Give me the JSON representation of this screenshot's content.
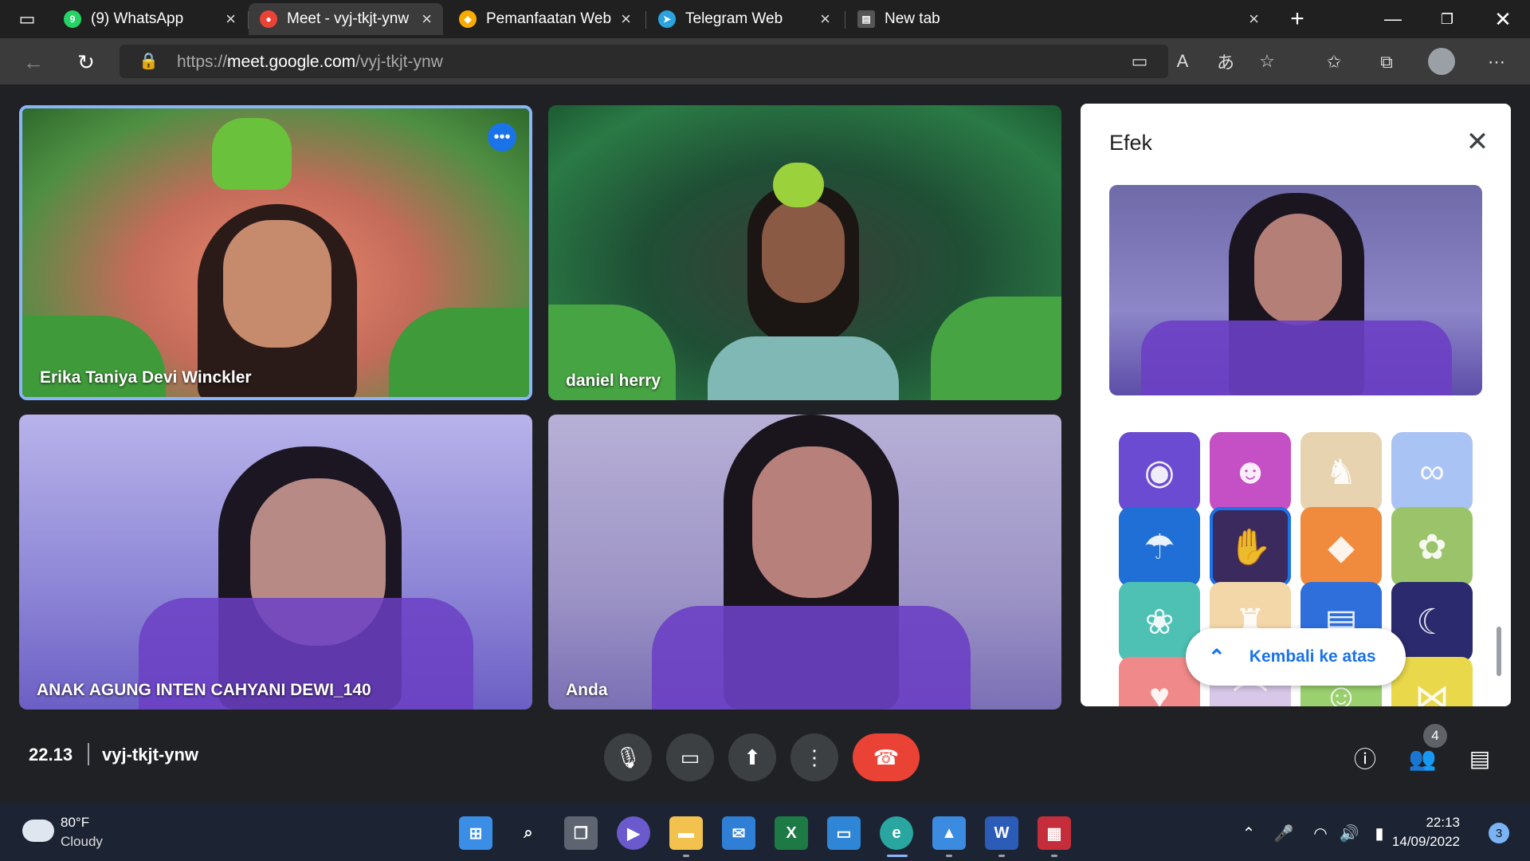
{
  "browser": {
    "tabs": [
      {
        "label": "(9) WhatsApp",
        "favicon": "whatsapp-icon",
        "color": "#25d366",
        "badge": "9"
      },
      {
        "label": "Meet - vyj-tkjt-ynw",
        "favicon": "meet-icon",
        "color": "#ea4335",
        "active": true
      },
      {
        "label": "Pemanfaatan Web Sebaga",
        "favicon": "site-icon",
        "color": "#f9ab00"
      },
      {
        "label": "Telegram Web",
        "favicon": "telegram-icon",
        "color": "#2aa3de"
      },
      {
        "label": "New tab",
        "favicon": "newtab-icon",
        "color": "#555555"
      }
    ],
    "url_scheme": "https://",
    "url_host": "meet.google.com",
    "url_path": "/vyj-tkjt-ynw"
  },
  "meet": {
    "participants": [
      {
        "name": "Erika Taniya Devi Winckler",
        "background": "jungle",
        "speaking": true
      },
      {
        "name": "daniel herry",
        "background": "jungle"
      },
      {
        "name": "ANAK AGUNG INTEN CAHYANI DEWI_140",
        "background": "purple-hands"
      },
      {
        "name": "Anda",
        "background": "purple-hands"
      }
    ],
    "effects_panel": {
      "title": "Efek",
      "back_to_top_label": "Kembali ke atas",
      "effects": [
        {
          "icon": "monster-effect-icon",
          "color": "#6b4bd1"
        },
        {
          "icon": "dinosaur-effect-icon",
          "color": "#c54fc5"
        },
        {
          "icon": "dog-effect-icon",
          "color": "#e7d3b0"
        },
        {
          "icon": "cat-glasses-effect-icon",
          "color": "#a9c3f5"
        },
        {
          "icon": "jellyfish-effect-icon",
          "color": "#1f6fd6"
        },
        {
          "icon": "purple-hands-effect-icon",
          "color": "#3b2a5e",
          "selected": true
        },
        {
          "icon": "fish-effect-icon",
          "color": "#f08a3c"
        },
        {
          "icon": "flower-effect-icon",
          "color": "#9bc46a"
        },
        {
          "icon": "daisy-effect-icon",
          "color": "#4fc1b4"
        },
        {
          "icon": "castle-effect-icon",
          "color": "#f3d7a8"
        },
        {
          "icon": "book-effect-icon",
          "color": "#2f6fdc"
        },
        {
          "icon": "bear-moon-effect-icon",
          "color": "#2b2a6e"
        },
        {
          "icon": "heart-effect-icon",
          "color": "#f08a8a"
        },
        {
          "icon": "rainbow-effect-icon",
          "color": "#d8c7e8"
        },
        {
          "icon": "frog-effect-icon",
          "color": "#9ad16e"
        },
        {
          "icon": "bow-effect-icon",
          "color": "#e8d84a"
        }
      ]
    },
    "time": "22.13",
    "meeting_code": "vyj-tkjt-ynw",
    "people_count": "4"
  },
  "taskbar": {
    "weather_temp": "80°F",
    "weather_desc": "Cloudy",
    "clock_time": "22:13",
    "clock_date": "14/09/2022",
    "notification_count": "3"
  }
}
